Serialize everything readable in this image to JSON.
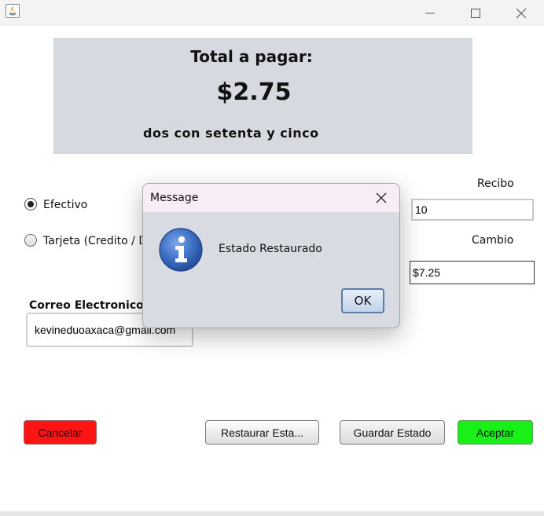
{
  "window": {
    "minimize_icon": "minimize-icon",
    "maximize_icon": "maximize-icon",
    "close_icon": "close-icon"
  },
  "total": {
    "title": "Total a pagar:",
    "amount": "$2.75",
    "words": "dos con setenta y cinco",
    "panel_color": "#d6d9df"
  },
  "payment": {
    "options": [
      {
        "label": "Efectivo",
        "selected": true
      },
      {
        "label": "Tarjeta (Credito / De",
        "selected": false
      }
    ]
  },
  "recibo": {
    "label": "Recibo",
    "value": "10"
  },
  "cambio": {
    "label": "Cambio",
    "value": "$7.25"
  },
  "email": {
    "label": "Correo Electronico",
    "value": "kevineduoaxaca@gmail.com"
  },
  "buttons": {
    "cancel": {
      "label": "Cancelar",
      "color": "#ff1414"
    },
    "restore": {
      "label": "Restaurar Esta..."
    },
    "save": {
      "label": "Guardar Estado"
    },
    "accept": {
      "label": "Aceptar",
      "color": "#18f018"
    }
  },
  "dialog": {
    "title": "Message",
    "message": "Estado Restaurado",
    "ok_label": "OK",
    "icon": "info-icon",
    "icon_color": "#3c6fc3"
  }
}
